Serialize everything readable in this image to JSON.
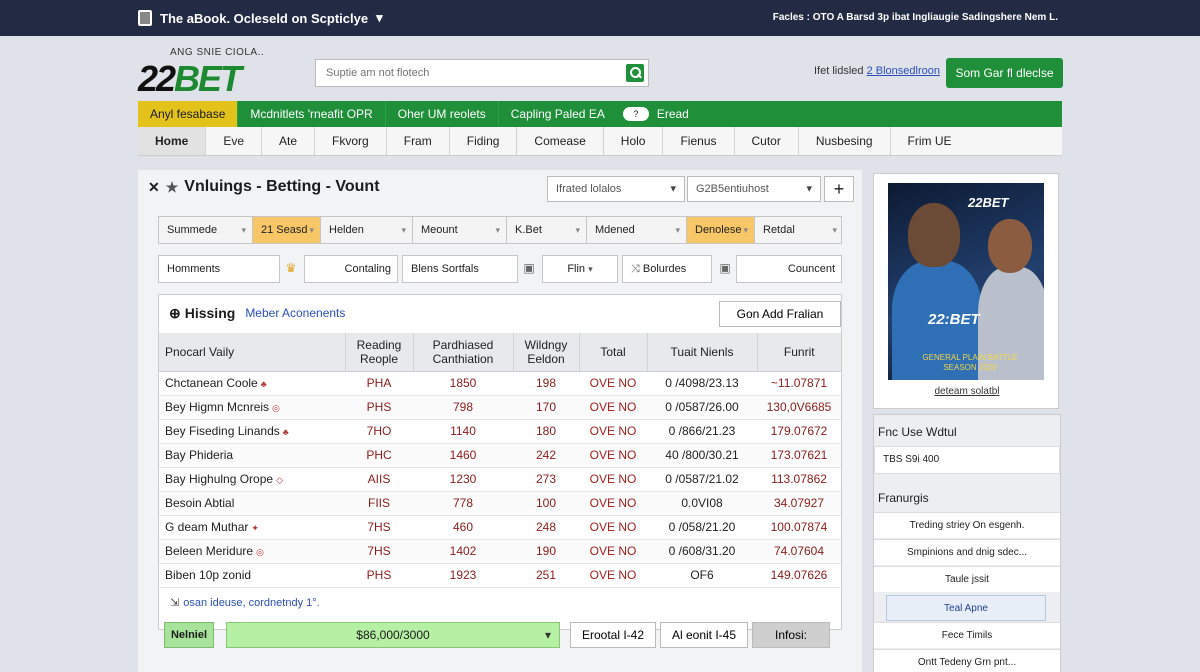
{
  "topbar": {
    "title": "The aBook. Ocleseld on Scpticlye",
    "right_text": "Facles : OTO   A Barsd 3p ibat Ingliaugie Sadingshere Nem L."
  },
  "header": {
    "brand_sub": "ANG SNIE CIOLA..",
    "brand_num": "22",
    "brand_bet": "BET",
    "search_placeholder": "Suptie am not flotech",
    "link_prefix": "Ifet lidsled",
    "link_text": "2 Blonsedlroon",
    "cta_label": "Som Gar fl dleclse"
  },
  "promo": {
    "items": [
      "Anyl fesabase",
      "Mcdnitlets 'rneafit OPR",
      "Oher UM reolets",
      "Capling Paled EA"
    ],
    "toggle": "?",
    "tail": "Eread"
  },
  "nav": {
    "tabs": [
      "Home",
      "Eve",
      "Ate",
      "Fkvorg",
      "Fram",
      "Fiding",
      "Comease",
      "Holo",
      "Fienus",
      "Cutor",
      "Nusbesing",
      "Frim UE"
    ]
  },
  "main": {
    "title": "Vnluings - Betting - Vount",
    "select1": "Ifrated lolalos",
    "select2": "G2B5entiuhost",
    "add": "+",
    "filters": [
      {
        "label": "Summede",
        "w": 94,
        "hl": false
      },
      {
        "label": "21 Seasd",
        "w": 68,
        "hl": true
      },
      {
        "label": "Helden",
        "w": 92,
        "hl": false
      },
      {
        "label": "Meount",
        "w": 94,
        "hl": false
      },
      {
        "label": "K.Bet",
        "w": 80,
        "hl": false
      },
      {
        "label": "Mdened",
        "w": 100,
        "hl": false
      },
      {
        "label": "Denolese",
        "w": 68,
        "hl": true
      },
      {
        "label": "Retdal",
        "w": 88,
        "hl": false
      }
    ],
    "chips": [
      "Homments",
      "Contaling",
      "Blens Sortfals",
      "Flin",
      "Bolurdes",
      "Councent"
    ],
    "table_head": "Hissing",
    "table_sub": "Meber Aconenents",
    "add_btn": "Gon Add Fralian",
    "columns": [
      "Pnocarl Vaily",
      "Reading Reople",
      "Pardhiased Canthiation",
      "Wildngy Eeldon",
      "Total",
      "Tuait Nienls",
      "Funrit"
    ],
    "rows": [
      [
        "Chctanean Coole",
        "PHA",
        "1850",
        "198",
        "OVE NO",
        "0 /4098/23.13",
        "~11.07871"
      ],
      [
        "Bey Higmn Mcnreis",
        "PHS",
        "798",
        "170",
        "OVE NO",
        "0 /0587/26.00",
        "130,0V6685"
      ],
      [
        "Bey Fiseding Linands",
        "7HO",
        "1140",
        "180",
        "OVE NO",
        "0 /866/21.23",
        "179.07672"
      ],
      [
        "Bay Phideria",
        "PHC",
        "1460",
        "242",
        "OVE NO",
        "40 /800/30.21",
        "173.07621"
      ],
      [
        "Bay Highulng Orope",
        "AIIS",
        "1230",
        "273",
        "OVE NO",
        "0 /0587/21.02",
        "113.07862"
      ],
      [
        "Besoin Abtial",
        "FIIS",
        "778",
        "100",
        "OVE NO",
        "0.0VI08",
        "34.07927"
      ],
      [
        "G deam Muthar",
        "7HS",
        "460",
        "248",
        "OVE NO",
        "0 /058/21.20",
        "100.07874"
      ],
      [
        "Beleen Meridure",
        "7HS",
        "1402",
        "190",
        "OVE NO",
        "0 /608/31.20",
        "74.07604"
      ],
      [
        "Biben 10p zonid",
        "PHS",
        "1923",
        "251",
        "OVE NO",
        "OF6",
        "149.07626"
      ]
    ],
    "foot_note": "osan ideuse, cordnetndy 1°.",
    "bottom": {
      "label": "Nelniel",
      "select": "$86,000/3000",
      "btn1": "Erootal I-42",
      "btn2": "Al eonit I-45",
      "btn3": "Infosi:"
    }
  },
  "sidebar": {
    "ad_brand": "22BET",
    "ad_brand2": "22:BET",
    "ad_text": "GENERAL PLAIN BATTLE SEASON 2020",
    "ad_link": "deteam solatbl",
    "heading1": "Fnc Use Wdtul",
    "box1": "TBS S9i 400",
    "heading2": "Franurgis",
    "list": [
      "Treding striey On esgenh.",
      "Smpinions and dnig sdec...",
      "Taule jssit",
      "Teal Apne",
      "Fece Timils",
      "Ontt Tedeny Grn pnt..."
    ]
  }
}
